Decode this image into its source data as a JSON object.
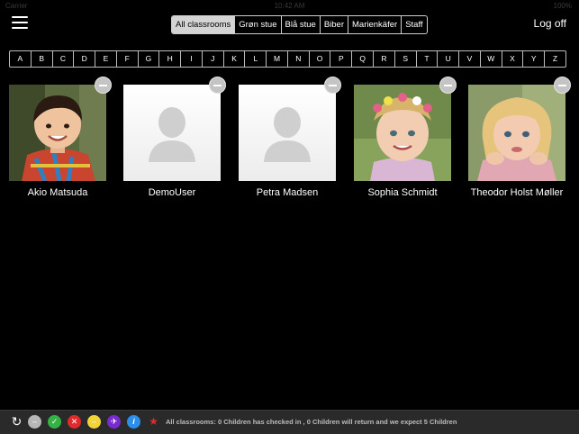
{
  "statusbar": {
    "carrier": "Carrier",
    "time": "10:42 AM",
    "battery": "100%"
  },
  "nav": {
    "tabs": [
      {
        "label": "All classrooms",
        "active": true
      },
      {
        "label": "Grøn stue",
        "active": false
      },
      {
        "label": "Blå stue",
        "active": false
      },
      {
        "label": "Biber",
        "active": false
      },
      {
        "label": "Marienkäfer",
        "active": false
      },
      {
        "label": "Staff",
        "active": false
      }
    ],
    "logoff": "Log off"
  },
  "alphabet": [
    "A",
    "B",
    "C",
    "D",
    "E",
    "F",
    "G",
    "H",
    "I",
    "J",
    "K",
    "L",
    "M",
    "N",
    "O",
    "P",
    "Q",
    "R",
    "S",
    "T",
    "U",
    "V",
    "W",
    "X",
    "Y",
    "Z"
  ],
  "children": [
    {
      "name": "Akio Matsuda",
      "photo": "child-photo-boy"
    },
    {
      "name": "DemoUser",
      "photo": "placeholder"
    },
    {
      "name": "Petra Madsen",
      "photo": "placeholder"
    },
    {
      "name": "Sophia Schmidt",
      "photo": "child-photo-girl-flowers"
    },
    {
      "name": "Theodor Holst Møller",
      "photo": "child-photo-girl-blonde"
    }
  ],
  "toolbar": {
    "icons": [
      "refresh-icon",
      "absent-icon",
      "checked-in-icon",
      "checked-out-icon",
      "sick-icon",
      "vacation-icon",
      "info-icon",
      "running-icon"
    ],
    "status": "All classrooms: 0 Children has checked in , 0 Children will return and we expect 5 Children"
  }
}
